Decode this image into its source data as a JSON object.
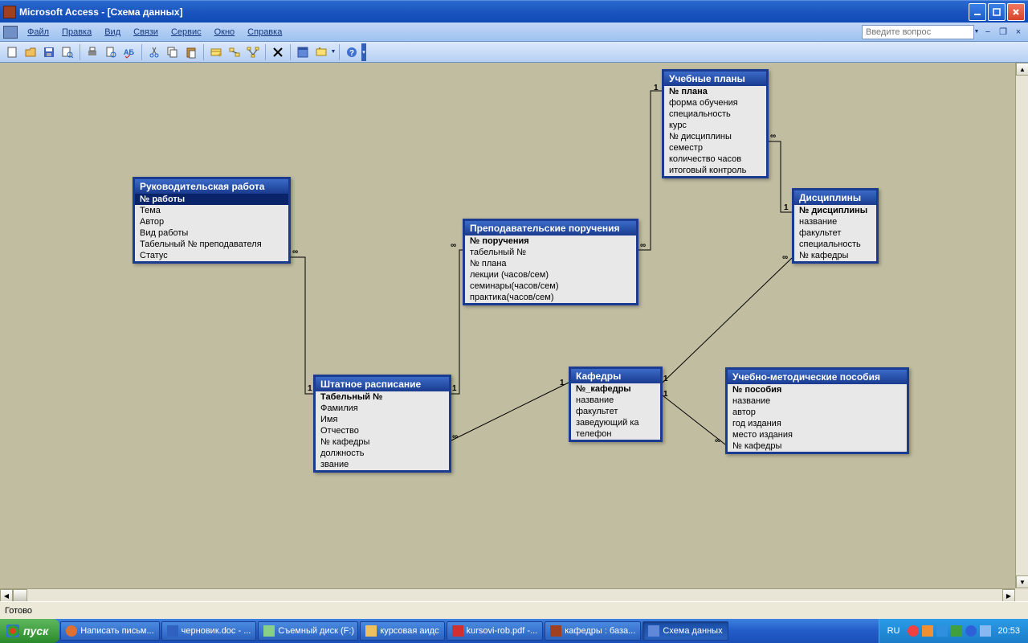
{
  "app_title": "Microsoft Access - [Схема данных]",
  "menu": {
    "file": "Файл",
    "edit": "Правка",
    "view": "Вид",
    "relations": "Связи",
    "service": "Сервис",
    "window": "Окно",
    "help": "Справка"
  },
  "help_placeholder": "Введите вопрос",
  "status": "Готово",
  "tables": {
    "ruk": {
      "title": "Руководительская работа",
      "fields": [
        "№ работы",
        "Тема",
        "Автор",
        "Вид работы",
        "Табельный № преподавателя",
        "Статус"
      ]
    },
    "prep": {
      "title": "Преподавательские поручения",
      "fields": [
        "№ поручения",
        "табельный №",
        "№ плана",
        "лекции (часов/сем)",
        "семинары(часов/сем)",
        "практика(часов/сем)"
      ]
    },
    "plan": {
      "title": "Учебные планы",
      "fields": [
        "№ плана",
        "форма обучения",
        "специальность",
        "курс",
        "№ дисциплины",
        "семестр",
        "количество часов",
        "итоговый контроль"
      ]
    },
    "disc": {
      "title": "Дисциплины",
      "fields": [
        "№ дисциплины",
        "название",
        "факультет",
        "специальность",
        "№ кафедры"
      ]
    },
    "sht": {
      "title": "Штатное расписание",
      "fields": [
        "Табельный №",
        "Фамилия",
        "Имя",
        "Отчество",
        "№ кафедры",
        "должность",
        "звание"
      ]
    },
    "kaf": {
      "title": "Кафедры",
      "fields": [
        "№_кафедры",
        "название",
        "факультет",
        "заведующий ка",
        "телефон"
      ]
    },
    "posob": {
      "title": "Учебно-методические пособия",
      "fields": [
        "№ пособия",
        "название",
        "автор",
        "год издания",
        "место издания",
        "№  кафедры"
      ]
    }
  },
  "taskbar": {
    "start": "пуск",
    "items": [
      "Написать письм...",
      "черновик.doc - ...",
      "Съемный диск (F:)",
      "курсовая аидс",
      "kursovi-rob.pdf -...",
      "кафедры : база...",
      "Схема данных"
    ],
    "lang": "RU",
    "time": "20:53"
  },
  "rel_labels": {
    "one": "1",
    "many": "∞"
  }
}
